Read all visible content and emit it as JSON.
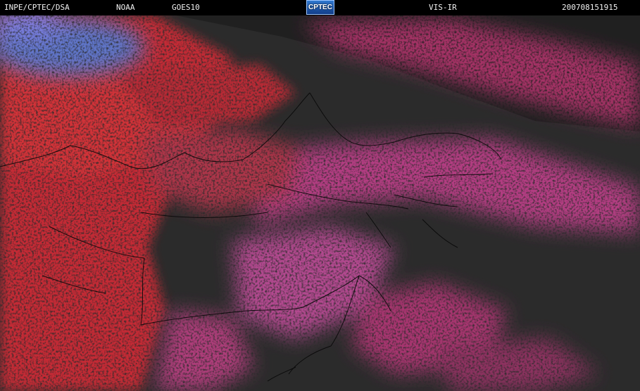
{
  "header": {
    "institution": "INPE/CPTEC/DSA",
    "agency": "NOAA",
    "satellite": "GOES10",
    "logo_text": "CPTEC",
    "channel": "VIS-IR",
    "timestamp": "200708151915"
  },
  "colors": {
    "background": "#2b2b2b",
    "cold_cloud_red": "#c52c36",
    "warm_cloud_magenta": "#b33c82",
    "high_cloud_blue": "#5e74c8",
    "borders": "#050505"
  }
}
